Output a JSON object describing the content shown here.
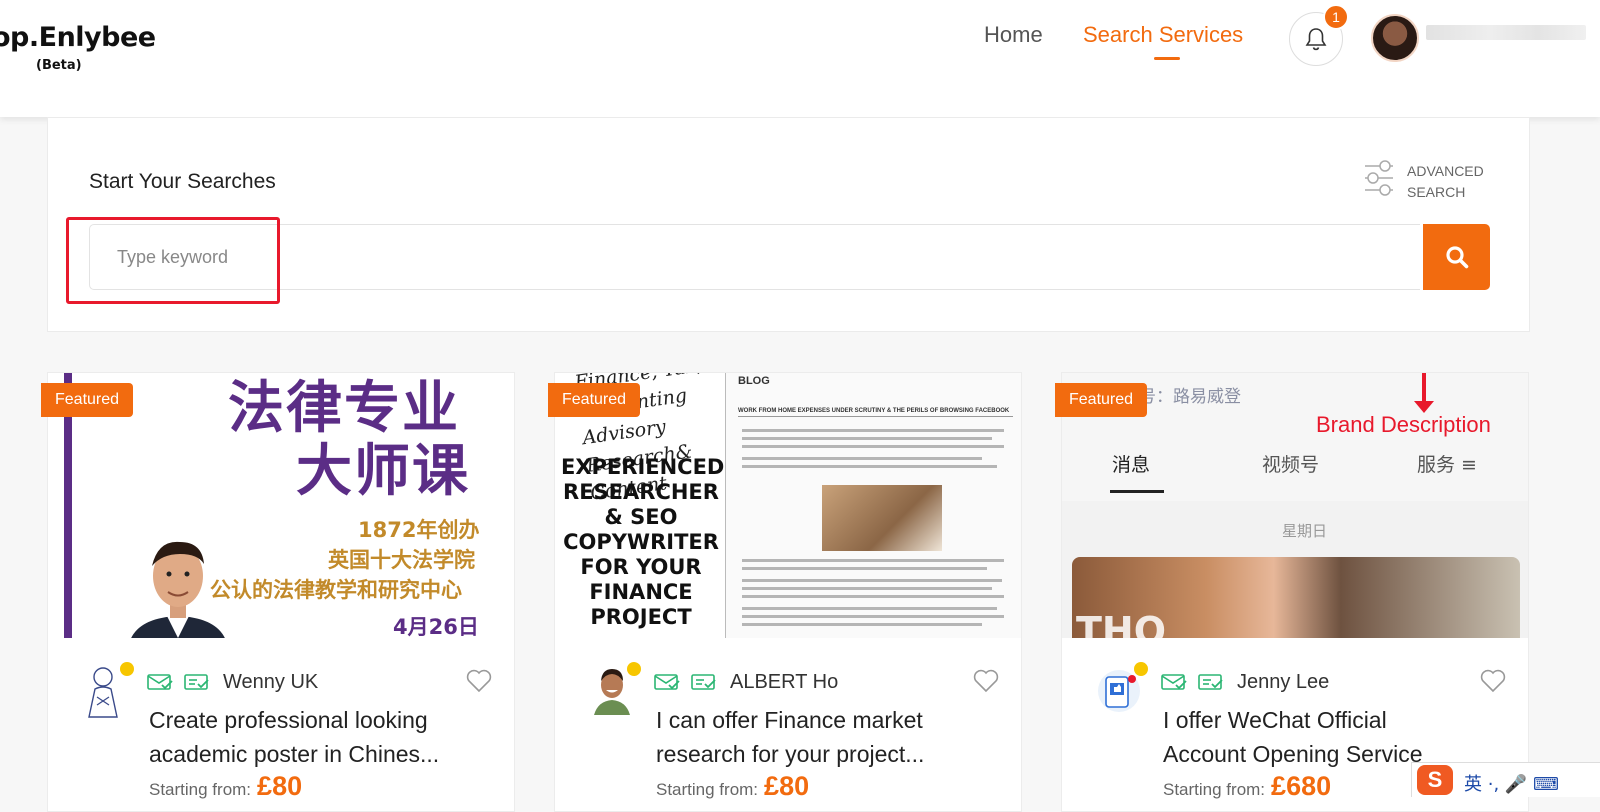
{
  "header": {
    "logo": "op.Enlybee",
    "logo_sub": "(Beta)",
    "nav": [
      {
        "label": "Home"
      },
      {
        "label": "Search Services"
      }
    ],
    "notification_count": "1",
    "accent_color": "#f26b0f"
  },
  "search": {
    "title": "Start Your Searches",
    "advanced_line1": "ADVANCED",
    "advanced_line2": "SEARCH",
    "placeholder": "Type keyword",
    "value": ""
  },
  "cards": [
    {
      "badge": "Featured",
      "seller": "Wenny UK",
      "title_line1": "Create professional looking",
      "title_line2": "academic poster in Chines...",
      "price_label": "Starting from:",
      "price": "£80",
      "art": {
        "line1": "法律专业",
        "line2": "大师课",
        "line3": "1872年创办",
        "line4": "英国十大法学院",
        "line5": "公认的法律教学和研究中心",
        "line6": "4月26日"
      }
    },
    {
      "badge": "Featured",
      "seller": "ALBERT Ho",
      "title_line1": "I can offer Finance market",
      "title_line2": "research for your project...",
      "price_label": "Starting from:",
      "price": "£80",
      "art": {
        "script1": "Finance, Tax,",
        "script2": "Accounting Advisory",
        "script3": "Research& Content",
        "big1": "EXPERIENCED",
        "big2": "RESEARCHER",
        "big3": "& SEO",
        "big4": "COPYWRITER",
        "big5": "FOR YOUR",
        "big6": "FINANCE",
        "big7": "PROJECT",
        "blog": "BLOG",
        "heading": "WORK FROM HOME EXPENSES UNDER SCRUTINY & THE PERILS OF BROWSING FACEBOOK"
      }
    },
    {
      "badge": "Featured",
      "seller": "Jenny Lee",
      "title_line1": "I offer WeChat Official",
      "title_line2": "Account Opening Service",
      "price_label": "Starting from:",
      "price": "£680",
      "art": {
        "top_text": "11 视频号：路易威登",
        "brand": "Brand Description",
        "tab1": "消息",
        "tab2": "视频号",
        "tab3": "服务 ≡",
        "day": "星期日",
        "overlay": "THO"
      }
    }
  ],
  "ime": {
    "logo": "S",
    "text": "英 ·, 🎤 ⌨"
  }
}
